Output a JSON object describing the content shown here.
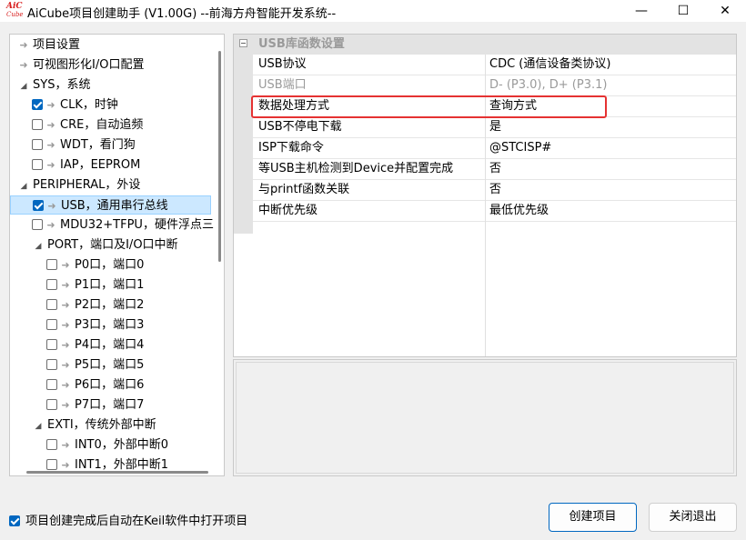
{
  "window": {
    "title": "AiCube项目创建助手 (V1.00G) --前海方舟智能开发系统--",
    "logo_text_top": "AiC",
    "logo_text_bottom": "Cube",
    "minimize_glyph": "—",
    "maximize_glyph": "☐",
    "close_glyph": "✕"
  },
  "tree": {
    "items": [
      {
        "label": "项目设置",
        "indent": 0,
        "kind": "arrow"
      },
      {
        "label": "可视图形化I/O口配置",
        "indent": 0,
        "kind": "arrow"
      },
      {
        "label": "SYS，系统",
        "indent": 0,
        "kind": "group"
      },
      {
        "label": "CLK，时钟",
        "indent": 1,
        "kind": "check",
        "checked": true
      },
      {
        "label": "CRE，自动追频",
        "indent": 1,
        "kind": "check",
        "checked": false
      },
      {
        "label": "WDT，看门狗",
        "indent": 1,
        "kind": "check",
        "checked": false
      },
      {
        "label": "IAP，EEPROM",
        "indent": 1,
        "kind": "check",
        "checked": false
      },
      {
        "label": "PERIPHERAL，外设",
        "indent": 0,
        "kind": "group"
      },
      {
        "label": "USB，通用串行总线",
        "indent": 1,
        "kind": "check",
        "checked": true,
        "selected": true
      },
      {
        "label": "MDU32+TFPU，硬件浮点三",
        "indent": 1,
        "kind": "check",
        "checked": false
      },
      {
        "label": "PORT，端口及I/O口中断",
        "indent": 1,
        "kind": "group"
      },
      {
        "label": "P0口，端口0",
        "indent": 2,
        "kind": "check",
        "checked": false
      },
      {
        "label": "P1口，端口1",
        "indent": 2,
        "kind": "check",
        "checked": false
      },
      {
        "label": "P2口，端口2",
        "indent": 2,
        "kind": "check",
        "checked": false
      },
      {
        "label": "P3口，端口3",
        "indent": 2,
        "kind": "check",
        "checked": false
      },
      {
        "label": "P4口，端口4",
        "indent": 2,
        "kind": "check",
        "checked": false
      },
      {
        "label": "P5口，端口5",
        "indent": 2,
        "kind": "check",
        "checked": false
      },
      {
        "label": "P6口，端口6",
        "indent": 2,
        "kind": "check",
        "checked": false
      },
      {
        "label": "P7口，端口7",
        "indent": 2,
        "kind": "check",
        "checked": false
      },
      {
        "label": "EXTI，传统外部中断",
        "indent": 1,
        "kind": "group"
      },
      {
        "label": "INT0，外部中断0",
        "indent": 2,
        "kind": "check",
        "checked": false
      },
      {
        "label": "INT1，外部中断1",
        "indent": 2,
        "kind": "check",
        "checked": false
      }
    ]
  },
  "grid": {
    "section": "USB库函数设置",
    "rows": [
      {
        "key": "USB协议",
        "value": "CDC (通信设备类协议)",
        "disabled": false
      },
      {
        "key": "USB端口",
        "value": "D- (P3.0), D+ (P3.1)",
        "disabled": true
      },
      {
        "key": "数据处理方式",
        "value": "查询方式",
        "disabled": false,
        "highlighted": true
      },
      {
        "key": "USB不停电下载",
        "value": "是",
        "disabled": false
      },
      {
        "key": "ISP下载命令",
        "value": "@STCISP#",
        "disabled": false
      },
      {
        "key": "等USB主机检测到Device并配置完成",
        "value": "否",
        "disabled": false
      },
      {
        "key": "与printf函数关联",
        "value": "否",
        "disabled": false
      },
      {
        "key": "中断优先级",
        "value": "最低优先级",
        "disabled": false
      }
    ]
  },
  "footer": {
    "auto_open_label": "项目创建完成后自动在Keil软件中打开项目",
    "auto_open_checked": true,
    "create_button": "创建项目",
    "close_button": "关闭退出"
  },
  "colors": {
    "accent": "#0067c0",
    "selection_bg": "#cce8ff",
    "highlight_border": "#e53232"
  }
}
